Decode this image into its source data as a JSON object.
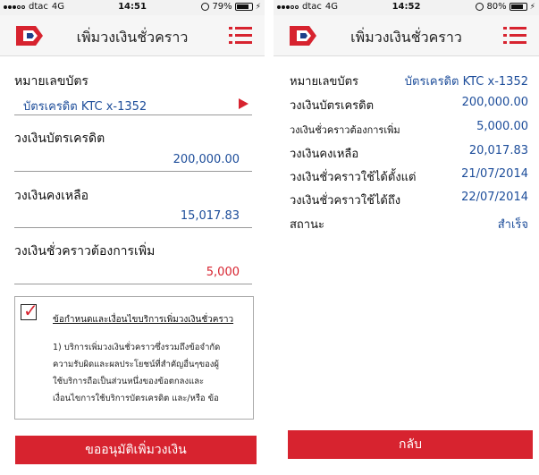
{
  "colors": {
    "accent": "#d7232f",
    "value_blue": "#1d4d9a"
  },
  "left": {
    "status": {
      "carrier": "dtac",
      "network": "4G",
      "time": "14:51",
      "battery": "79%",
      "battery_level": 0.79
    },
    "nav": {
      "title": "เพิ่มวงเงินชั่วคราว"
    },
    "form": {
      "card_label": "หมายเลขบัตร",
      "card_value": "บัตรเครดิต KTC x-1352",
      "limit_label": "วงเงินบัตรเครดิต",
      "limit_value": "200,000.00",
      "remaining_label": "วงเงินคงเหลือ",
      "remaining_value": "15,017.83",
      "request_label": "วงเงินชั่วคราวต้องการเพิ่ม",
      "request_value": "5,000"
    },
    "terms": {
      "checked": true,
      "title": "ข้อกำหนดและเงื่อนไขบริการเพิ่มวงเงินชั่วคราว",
      "lines": [
        "1) บริการเพิ่มวงเงินชั่วคราวซึ่งรวมถึงข้อจำกัด",
        "ความรับผิดและผลประโยชน์ที่สำคัญอื่นๆของผู้",
        "ใช้บริการถือเป็นส่วนหนึ่งของข้อตกลงและ",
        "เงื่อนไขการใช้บริการบัตรเครดิต และ/หรือ ข้อ"
      ]
    },
    "button": "ขออนุมัติเพิ่มวงเงิน"
  },
  "right": {
    "status": {
      "carrier": "dtac",
      "network": "4G",
      "time": "14:52",
      "battery": "80%",
      "battery_level": 0.8
    },
    "nav": {
      "title": "เพิ่มวงเงินชั่วคราว"
    },
    "summary": [
      {
        "label": "หมายเลขบัตร",
        "value": "บัตรเครดิต KTC x-1352"
      },
      {
        "label": "วงเงินบัตรเครดิต",
        "value": "200,000.00"
      },
      {
        "label": "วงเงินชั่วคราวต้องการเพิ่ม",
        "value": "5,000.00"
      },
      {
        "label": "วงเงินคงเหลือ",
        "value": "20,017.83"
      },
      {
        "label": "วงเงินชั่วคราวใช้ได้ตั้งแต่",
        "value": "21/07/2014"
      },
      {
        "label": "วงเงินชั่วคราวใช้ได้ถึง",
        "value": "22/07/2014"
      },
      {
        "label": "สถานะ",
        "value": "สำเร็จ"
      }
    ],
    "button": "กลับ"
  },
  "icons": [
    "ktc-logo",
    "menu-icon",
    "dropdown-arrow-icon",
    "checkbox-tick-icon",
    "alarm-icon",
    "battery-icon",
    "charging-icon",
    "signal-icon"
  ]
}
